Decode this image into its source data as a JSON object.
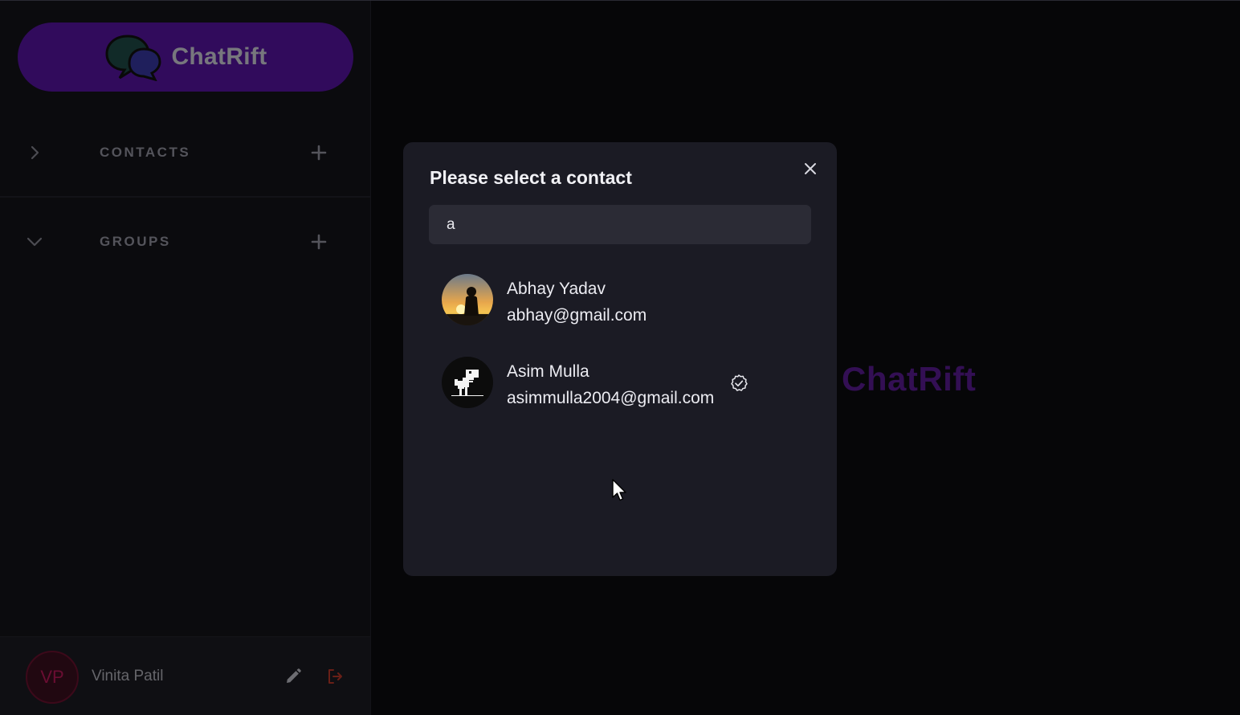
{
  "app": {
    "brand_name": "ChatRift",
    "main_brand": "ChatRift"
  },
  "sidebar": {
    "sections": [
      {
        "label": "CONTACTS",
        "expanded": false
      },
      {
        "label": "GROUPS",
        "expanded": true
      }
    ],
    "user": {
      "initials": "VP",
      "name": "Vinita Patil"
    }
  },
  "modal": {
    "title": "Please select a contact",
    "search": {
      "value": "a"
    },
    "contacts": [
      {
        "name": "Abhay Yadav",
        "email": "abhay@gmail.com",
        "selected": false,
        "avatar": "sunset-silhouette"
      },
      {
        "name": "Asim Mulla",
        "email": "asimmulla2004@gmail.com",
        "selected": true,
        "avatar": "dino"
      }
    ]
  },
  "colors": {
    "brand_purple": "#5a14a8",
    "main_brand_text": "#5d1d9a",
    "modal_bg": "#1b1b24",
    "logout_red": "#c0392b",
    "avatar_vp": "#c2185b"
  }
}
